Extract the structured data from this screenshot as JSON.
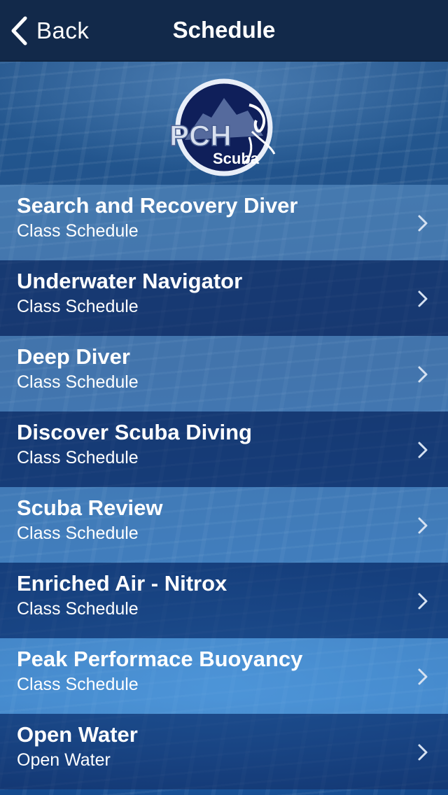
{
  "navbar": {
    "back_label": "Back",
    "title": "Schedule"
  },
  "logo": {
    "main_text": "PCH",
    "sub_text": "Scuba"
  },
  "schedule": {
    "items": [
      {
        "title": "Search and Recovery Diver",
        "subtitle": "Class Schedule"
      },
      {
        "title": "Underwater Navigator",
        "subtitle": "Class Schedule"
      },
      {
        "title": "Deep Diver",
        "subtitle": "Class Schedule"
      },
      {
        "title": "Discover Scuba Diving",
        "subtitle": "Class Schedule"
      },
      {
        "title": "Scuba Review",
        "subtitle": "Class Schedule"
      },
      {
        "title": "Enriched Air - Nitrox",
        "subtitle": "Class Schedule"
      },
      {
        "title": "Peak Performace Buoyancy",
        "subtitle": "Class Schedule"
      },
      {
        "title": "Open Water",
        "subtitle": "Open Water"
      }
    ]
  },
  "icons": {
    "back": "chevron-left-icon",
    "row_disclosure": "chevron-right-icon"
  },
  "colors": {
    "navbar": "#12294a",
    "row_light": "#5f8fc4",
    "row_dark": "#1d3b73",
    "text": "#ffffff"
  }
}
